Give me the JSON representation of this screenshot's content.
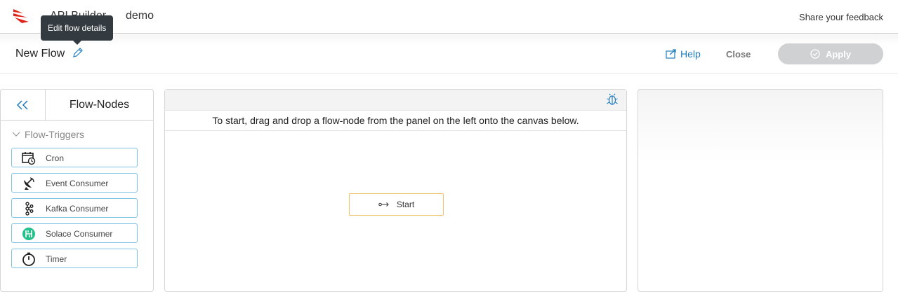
{
  "topbar": {
    "app_name": "API Builder",
    "project_name": "demo",
    "feedback_label": "Share your feedback",
    "brand_color": "#e2231a"
  },
  "tooltip": {
    "text": "Edit flow details"
  },
  "subbar": {
    "flow_title": "New Flow",
    "help_label": "Help",
    "close_label": "Close",
    "apply_label": "Apply"
  },
  "left_panel": {
    "title": "Flow-Nodes",
    "section": "Flow-Triggers",
    "nodes": [
      {
        "label": "Cron",
        "icon": "cron-calendar-icon"
      },
      {
        "label": "Event Consumer",
        "icon": "satellite-dish-icon"
      },
      {
        "label": "Kafka Consumer",
        "icon": "kafka-icon"
      },
      {
        "label": "Solace Consumer",
        "icon": "solace-icon"
      },
      {
        "label": "Timer",
        "icon": "stopwatch-icon"
      }
    ]
  },
  "canvas": {
    "instructions": "To start, drag and drop a flow-node from the panel on the left onto the canvas below.",
    "start_node_label": "Start"
  }
}
